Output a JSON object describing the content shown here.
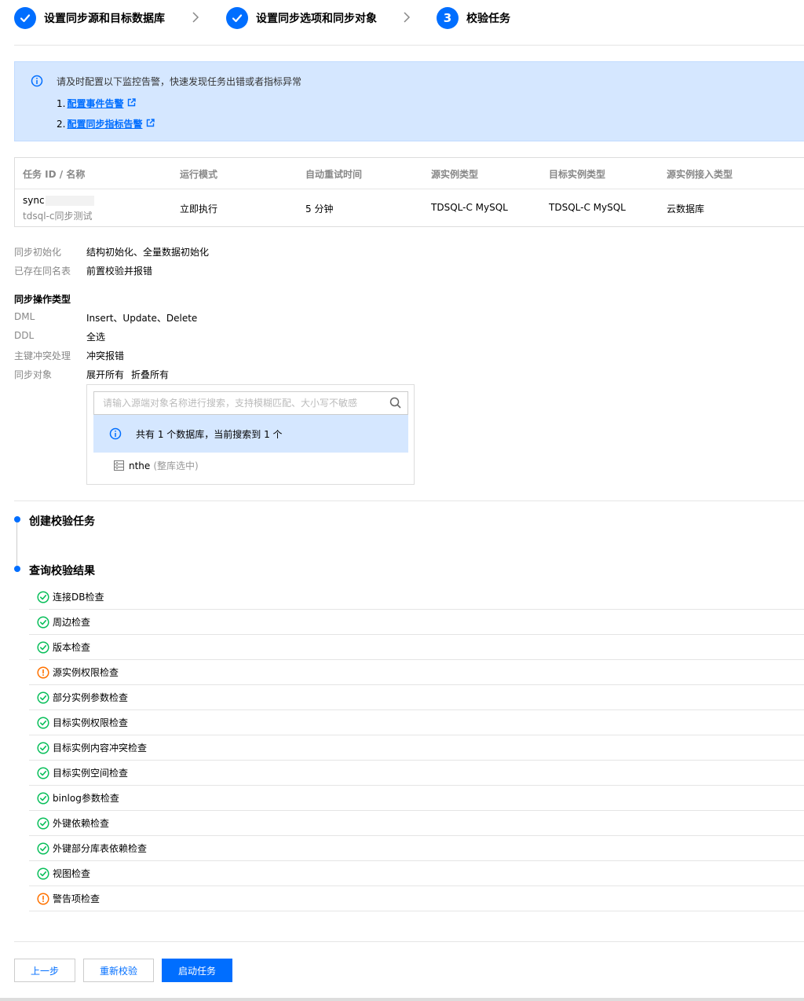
{
  "stepper": {
    "steps": [
      {
        "label": "设置同步源和目标数据库",
        "state": "done"
      },
      {
        "label": "设置同步选项和同步对象",
        "state": "done"
      },
      {
        "label": "校验任务",
        "state": "active",
        "number": "3"
      }
    ]
  },
  "alert": {
    "message": "请及时配置以下监控告警，快速发现任务出错或者指标异常",
    "links": [
      {
        "index": "1.",
        "label": "配置事件告警"
      },
      {
        "index": "2.",
        "label": "配置同步指标告警"
      }
    ]
  },
  "task_table": {
    "headers": [
      "任务 ID / 名称",
      "运行模式",
      "自动重试时间",
      "源实例类型",
      "目标实例类型",
      "源实例接入类型"
    ],
    "row": {
      "id": "sync",
      "name": "tdsql-c同步测试",
      "mode": "立即执行",
      "retry": "5 分钟",
      "source_type": "TDSQL-C MySQL",
      "target_type": "TDSQL-C MySQL",
      "access_type": "云数据库"
    }
  },
  "options": {
    "init_label": "同步初始化",
    "init_value": "结构初始化、全量数据初始化",
    "exist_label": "已存在同名表",
    "exist_value": "前置校验并报错",
    "op_title": "同步操作类型",
    "dml_label": "DML",
    "dml_value": "Insert、Update、Delete",
    "ddl_label": "DDL",
    "ddl_value": "全选",
    "conflict_label": "主键冲突处理",
    "conflict_value": "冲突报错",
    "objects_label": "同步对象",
    "expand_all": "展开所有",
    "collapse_all": "折叠所有"
  },
  "objects": {
    "search_placeholder": "请输入源端对象名称进行搜索，支持模糊匹配、大小写不敏感",
    "info": "共有 1 个数据库，当前搜索到 1 个",
    "db_name": "nthe",
    "db_note": "(整库选中)"
  },
  "timeline": {
    "create_title": "创建校验任务",
    "result_title": "查询校验结果"
  },
  "checks": [
    {
      "label": "连接DB检查",
      "status": "pass"
    },
    {
      "label": "周边检查",
      "status": "pass"
    },
    {
      "label": "版本检查",
      "status": "pass"
    },
    {
      "label": "源实例权限检查",
      "status": "warn"
    },
    {
      "label": "部分实例参数检查",
      "status": "pass"
    },
    {
      "label": "目标实例权限检查",
      "status": "pass"
    },
    {
      "label": "目标实例内容冲突检查",
      "status": "pass"
    },
    {
      "label": "目标实例空间检查",
      "status": "pass"
    },
    {
      "label": "binlog参数检查",
      "status": "pass"
    },
    {
      "label": "外键依赖检查",
      "status": "pass"
    },
    {
      "label": "外键部分库表依赖检查",
      "status": "pass"
    },
    {
      "label": "视图检查",
      "status": "pass"
    },
    {
      "label": "警告项检查",
      "status": "warn"
    }
  ],
  "colors": {
    "primary": "#006eff",
    "pass": "#0abf5b",
    "warn": "#ff7200"
  },
  "buttons": {
    "prev": "上一步",
    "recheck": "重新校验",
    "start": "启动任务"
  }
}
